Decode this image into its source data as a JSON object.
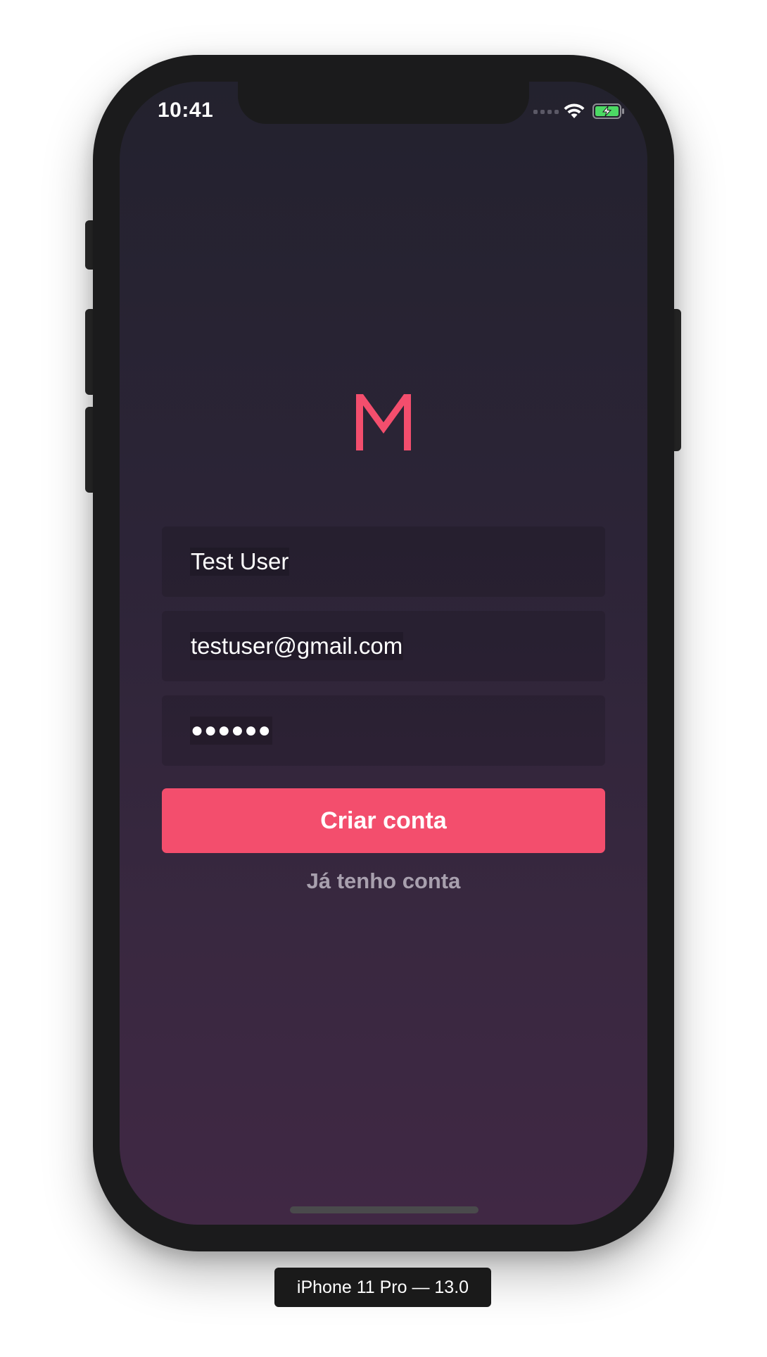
{
  "status_bar": {
    "time": "10:41",
    "signal_icon": "cellular-signal-icon",
    "wifi_icon": "wifi-icon",
    "battery_icon": "battery-charging-icon"
  },
  "logo": {
    "letter": "M",
    "color": "#f34e6d"
  },
  "form": {
    "name_value": "Test User",
    "email_value": "testuser@gmail.com",
    "password_value": "●●●●●●",
    "submit_label": "Criar conta",
    "login_link_label": "Já tenho conta"
  },
  "colors": {
    "accent": "#f34e6d",
    "background_top": "#23222e",
    "background_bottom": "#402844",
    "secondary_text": "#a8a0ae"
  },
  "simulator": {
    "label": "iPhone 11 Pro — 13.0"
  }
}
